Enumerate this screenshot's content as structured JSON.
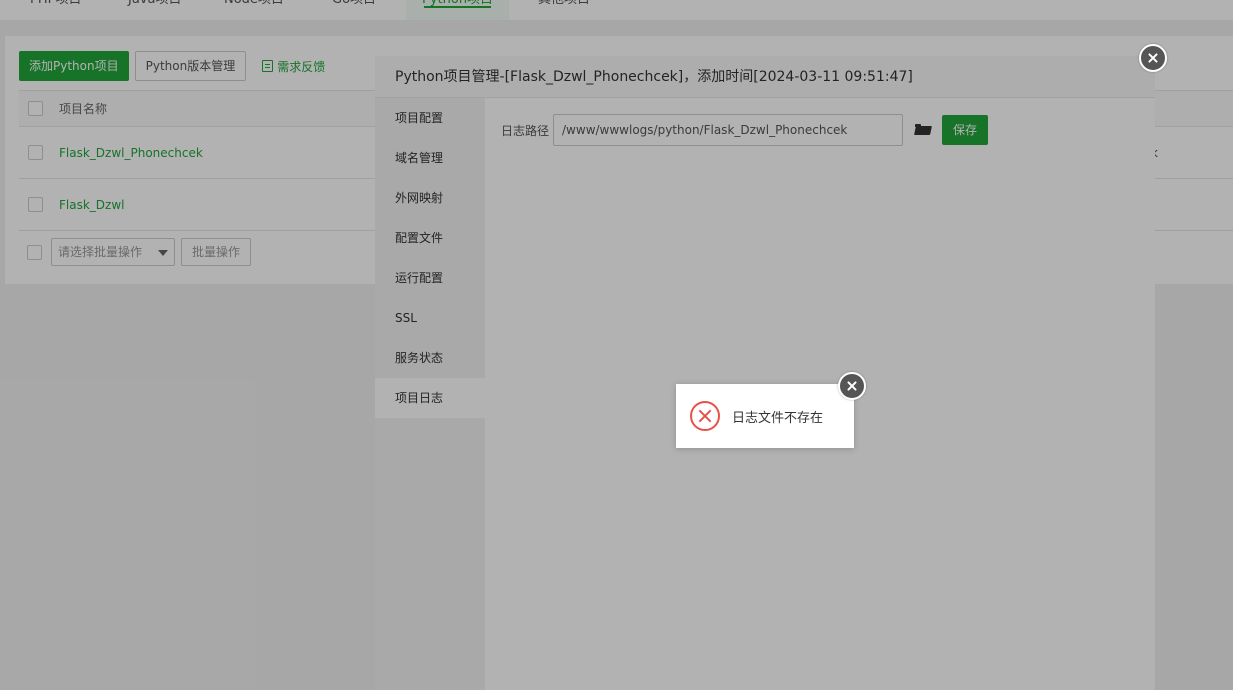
{
  "top_tabs": [
    "PHP项目",
    "Java项目",
    "Node项目",
    "Go项目",
    "Python项目",
    "其他项目"
  ],
  "toolbar": {
    "add_label": "添加Python项目",
    "version_label": "Python版本管理",
    "feedback_label": "需求反馈"
  },
  "table": {
    "header_name": "项目名称",
    "rows": [
      {
        "name": "Flask_Dzwl_Phonechcek",
        "tail": "k"
      },
      {
        "name": "Flask_Dzwl",
        "tail": ""
      }
    ]
  },
  "batch": {
    "select_placeholder": "请选择批量操作",
    "button_label": "批量操作"
  },
  "modal": {
    "title": "Python项目管理-[Flask_Dzwl_Phonechcek]，添加时间[2024-03-11 09:51:47]",
    "side_items": [
      "项目配置",
      "域名管理",
      "外网映射",
      "配置文件",
      "运行配置",
      "SSL",
      "服务状态",
      "项目日志"
    ],
    "active_item": "项目日志",
    "log_label": "日志路径",
    "log_path": "/www/wwwlogs/python/Flask_Dzwl_Phonechcek",
    "save_label": "保存"
  },
  "toast": {
    "message": "日志文件不存在",
    "icon": "error-x-icon"
  },
  "colors": {
    "accent": "#20a53a",
    "error": "#e8514a"
  }
}
